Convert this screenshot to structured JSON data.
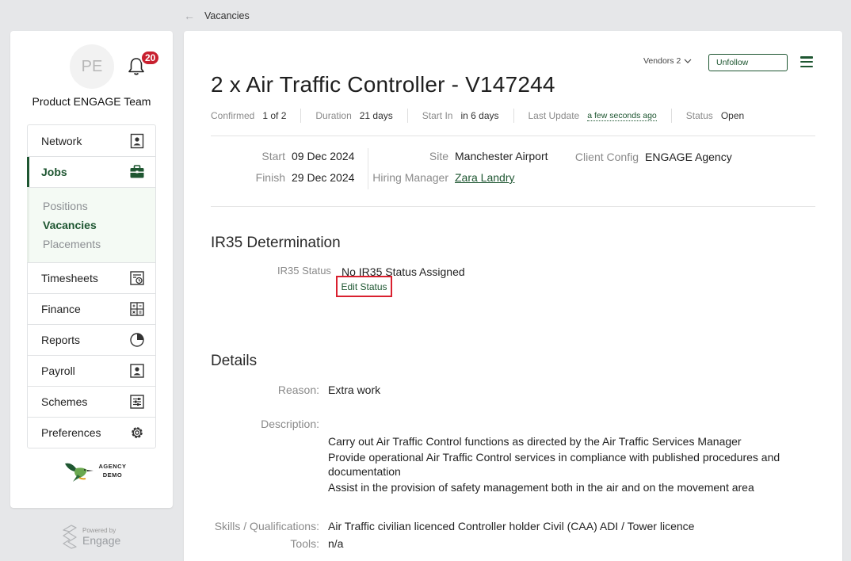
{
  "breadcrumb": {
    "label": "Vacancies"
  },
  "sidebar": {
    "avatar_initials": "PE",
    "notification_count": "20",
    "team_name": "Product ENGAGE Team",
    "nav": [
      {
        "label": "Network",
        "icon": "contact-card-icon"
      },
      {
        "label": "Jobs",
        "icon": "briefcase-icon"
      },
      {
        "label": "Timesheets",
        "icon": "timesheet-icon"
      },
      {
        "label": "Finance",
        "icon": "calculator-icon"
      },
      {
        "label": "Reports",
        "icon": "pie-chart-icon"
      },
      {
        "label": "Payroll",
        "icon": "person-card-icon"
      },
      {
        "label": "Schemes",
        "icon": "sliders-icon"
      },
      {
        "label": "Preferences",
        "icon": "gear-icon"
      }
    ],
    "jobs_sub": [
      "Positions",
      "Vacancies",
      "Placements"
    ],
    "agency_logo_text": "AGENCY DEMO",
    "powered_by": "Powered by",
    "powered_brand": "Engage"
  },
  "header": {
    "vendors_label": "Vendors 2",
    "unfollow_label": "Unfollow",
    "title": "2 x Air Traffic Controller - V147244"
  },
  "meta": {
    "confirmed_label": "Confirmed",
    "confirmed_value": "1 of 2",
    "duration_label": "Duration",
    "duration_value": "21 days",
    "start_in_label": "Start In",
    "start_in_value": "in 6 days",
    "last_update_label": "Last Update",
    "last_update_value": "a few seconds ago",
    "status_label": "Status",
    "status_value": "Open"
  },
  "info": {
    "start_label": "Start",
    "start_value": "09 Dec 2024",
    "finish_label": "Finish",
    "finish_value": "29 Dec 2024",
    "site_label": "Site",
    "site_value": "Manchester Airport",
    "hiring_manager_label": "Hiring Manager",
    "hiring_manager_value": "Zara Landry",
    "client_config_label": "Client Config",
    "client_config_value": "ENGAGE Agency"
  },
  "ir35": {
    "heading": "IR35 Determination",
    "status_label": "IR35 Status",
    "status_value": "No IR35 Status Assigned",
    "edit_label": "Edit Status"
  },
  "details": {
    "heading": "Details",
    "reason_label": "Reason:",
    "reason_value": "Extra work",
    "description_label": "Description:",
    "description_lines": [
      "Carry out Air Traffic Control functions as directed by the Air Traffic Services Manager",
      "Provide operational Air Traffic Control services in compliance with published procedures and documentation",
      "Assist in the provision of safety management both in the air and on the movement area"
    ],
    "skills_label": "Skills / Qualifications:",
    "skills_value": "Air Traffic civilian licenced Controller holder Civil (CAA) ADI / Tower licence",
    "tools_label": "Tools:",
    "tools_value": "n/a"
  },
  "colors": {
    "brand_green": "#1e5631",
    "badge_red": "#c8202f",
    "highlight_red": "#d9202f"
  }
}
